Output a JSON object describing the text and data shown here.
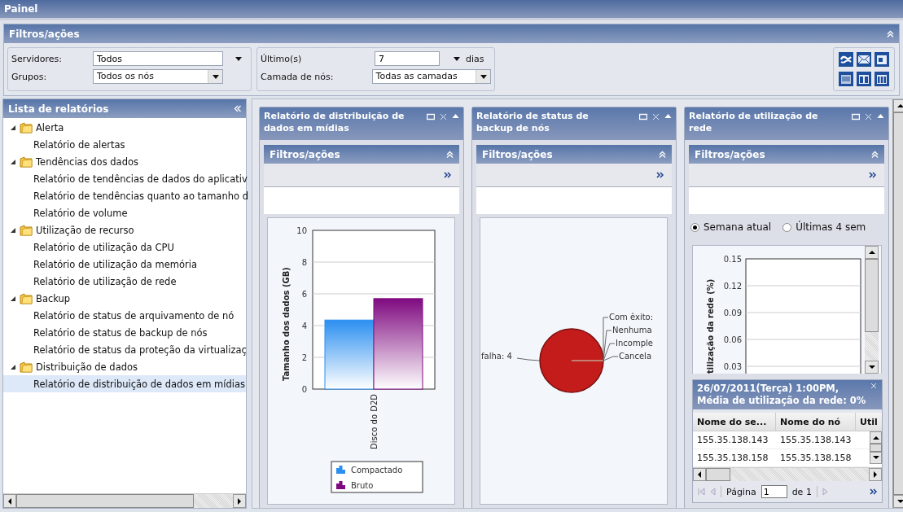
{
  "header": {
    "title": "Painel"
  },
  "filters": {
    "title": "Filtros/ações",
    "fields": [
      {
        "label": "Servidores:",
        "value": "Todos",
        "kind": "plain"
      },
      {
        "label": "Grupos:",
        "value": "Todos os nós",
        "kind": "combo"
      }
    ],
    "period": {
      "label": "Último(s)",
      "value": "7",
      "unit": "dias"
    },
    "tier": {
      "label": "Camada de nós:",
      "value": "Todas as camadas"
    }
  },
  "report_list": {
    "title": "Lista de relatórios",
    "items": [
      {
        "label": "Alerta",
        "expanded": true,
        "children": [
          {
            "label": "Relatório de alertas",
            "selected": false
          }
        ]
      },
      {
        "label": "Tendências dos dados",
        "expanded": true,
        "children": [
          {
            "label": "Relatório de tendências de dados do aplicativ",
            "selected": false
          },
          {
            "label": "Relatório de tendências quanto ao tamanho d",
            "selected": false
          },
          {
            "label": "Relatório de volume",
            "selected": false
          }
        ]
      },
      {
        "label": "Utilização de recurso",
        "expanded": true,
        "children": [
          {
            "label": "Relatório de utilização da CPU",
            "selected": false
          },
          {
            "label": "Relatório de utilização da memória",
            "selected": false
          },
          {
            "label": "Relatório de utilização de rede",
            "selected": false
          }
        ]
      },
      {
        "label": "Backup",
        "expanded": true,
        "children": [
          {
            "label": "Relatório de status de arquivamento de nó",
            "selected": false
          },
          {
            "label": "Relatório de status de backup de nós",
            "selected": false
          },
          {
            "label": "Relatório de status da proteção da virtualizaç",
            "selected": false
          }
        ]
      },
      {
        "label": "Distribuição de dados",
        "expanded": true,
        "children": [
          {
            "label": "Relatório de distribuição de dados em mídias",
            "selected": true
          }
        ]
      }
    ]
  },
  "portlets": [
    {
      "kind": "bar",
      "title": "Relatório de distribuição de dados em mídias",
      "filters_title": "Filtros/ações",
      "chart_data": {
        "type": "bar",
        "grid": true,
        "legend": true,
        "ylabel": "Tamanho dos dados (GB)",
        "categories": [
          "Disco do D2D"
        ],
        "ylim": [
          0,
          10
        ],
        "yticks": [
          0,
          2,
          4,
          6,
          8,
          10
        ],
        "series": [
          {
            "name": "Compactado",
            "color": "#2b8ff0",
            "values": [
              4.35
            ]
          },
          {
            "name": "Bruto",
            "color": "#7f0a80",
            "values": [
              5.7
            ]
          }
        ]
      }
    },
    {
      "kind": "pie",
      "title": "Relatório de status de backup de nós",
      "filters_title": "Filtros/ações",
      "pie": {
        "left_label": "falha: 4",
        "right_labels": [
          "Com êxito:",
          "Nenhuma",
          "Incomple",
          "Cancela"
        ]
      }
    },
    {
      "kind": "line",
      "title": "Relatório de utilização de rede",
      "filters_title": "Filtros/ações",
      "ranges": [
        {
          "label": "Semana atual",
          "selected": true
        },
        {
          "label": "Últimas 4 sem",
          "selected": false
        }
      ],
      "axis": {
        "ylabel": "tilização da rede (%)",
        "yticks": [
          "0.15",
          "0.12",
          "0.09",
          "0.06",
          "0.03"
        ]
      },
      "detail": {
        "title_lines": [
          "26/07/2011(Terça) 1:00PM,",
          "Média de utilização da rede: 0%"
        ],
        "columns": [
          "Nome do se...",
          "Nome do nó",
          "Util"
        ],
        "rows": [
          [
            "155.35.138.143",
            "155.35.138.143"
          ],
          [
            "155.35.138.158",
            "155.35.138.158"
          ]
        ],
        "pager": {
          "label": "Página",
          "page": "1",
          "of": "de 1"
        }
      }
    }
  ]
}
